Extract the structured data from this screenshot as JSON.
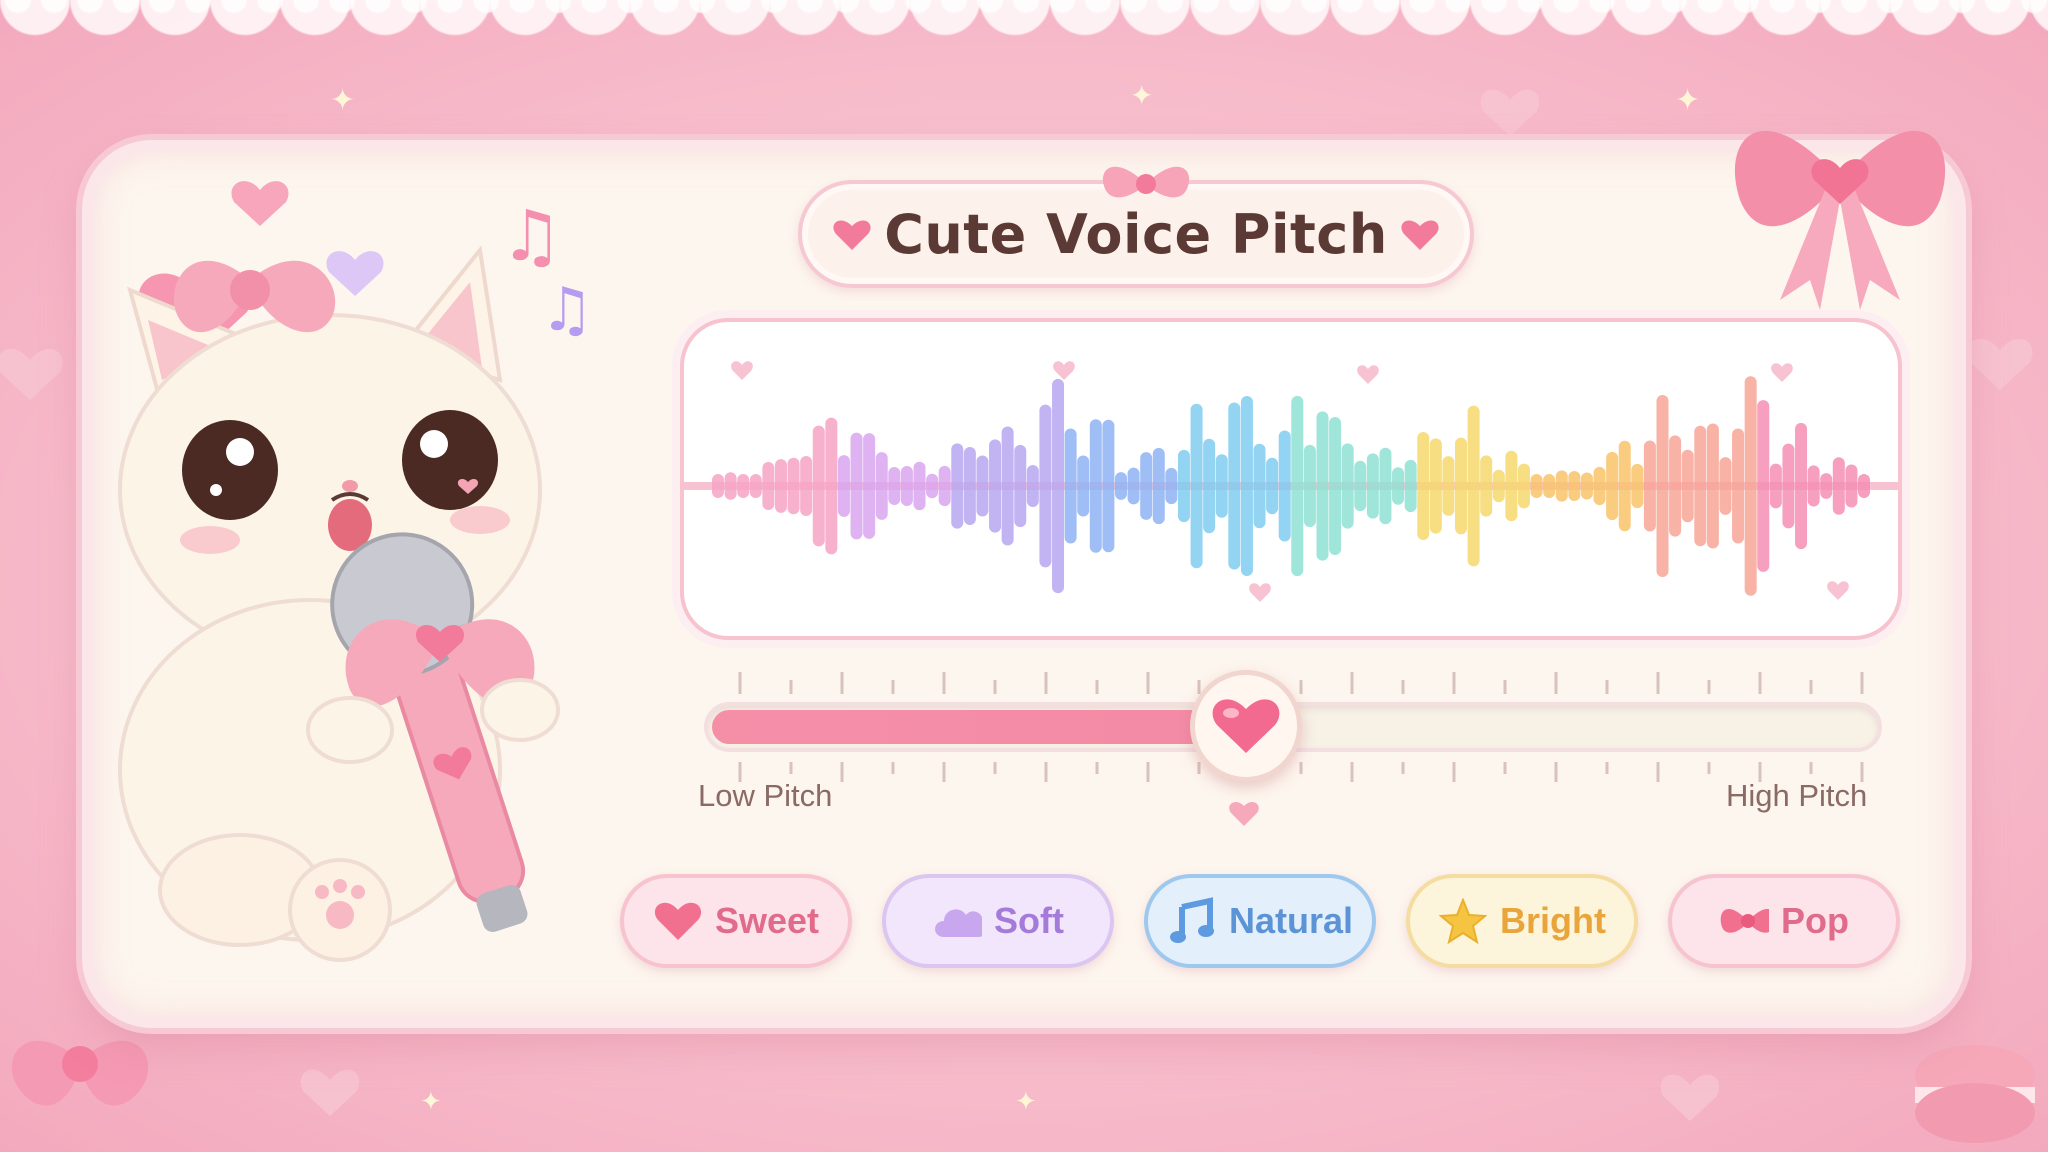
{
  "title": "Cute Voice Pitch",
  "slider": {
    "low_label": "Low Pitch",
    "high_label": "High Pitch",
    "value_fraction": 0.46,
    "fill_color": "#f48aa6"
  },
  "waveform": {
    "colors": [
      "#f6a3c3",
      "#d9a5ee",
      "#b7a7f0",
      "#8fb3f5",
      "#7fcdee",
      "#8fe0d2",
      "#f6d86d",
      "#f8c36a",
      "#f7a596",
      "#f58eb3"
    ]
  },
  "presets": [
    {
      "label": "Sweet",
      "icon": "heart-icon",
      "text_color": "#e06b8b",
      "bg": "#fde3ea",
      "border": "#f6c3cf"
    },
    {
      "label": "Soft",
      "icon": "cloud-icon",
      "text_color": "#a57bd9",
      "bg": "#f1e6fb",
      "border": "#dbc5f1"
    },
    {
      "label": "Natural",
      "icon": "music-note-icon",
      "text_color": "#5b93d6",
      "bg": "#e3f0fb",
      "border": "#9fc8ef"
    },
    {
      "label": "Bright",
      "icon": "star-icon",
      "text_color": "#e9a43a",
      "bg": "#fdf4dc",
      "border": "#f5dca0"
    },
    {
      "label": "Pop",
      "icon": "bow-icon",
      "text_color": "#e06b8b",
      "bg": "#fde3ea",
      "border": "#f6c3cf"
    }
  ],
  "colors": {
    "background": "#f7bccb",
    "panel": "#fdf6ee",
    "accent_pink": "#f48aa6",
    "title_text": "#5b3a35"
  }
}
